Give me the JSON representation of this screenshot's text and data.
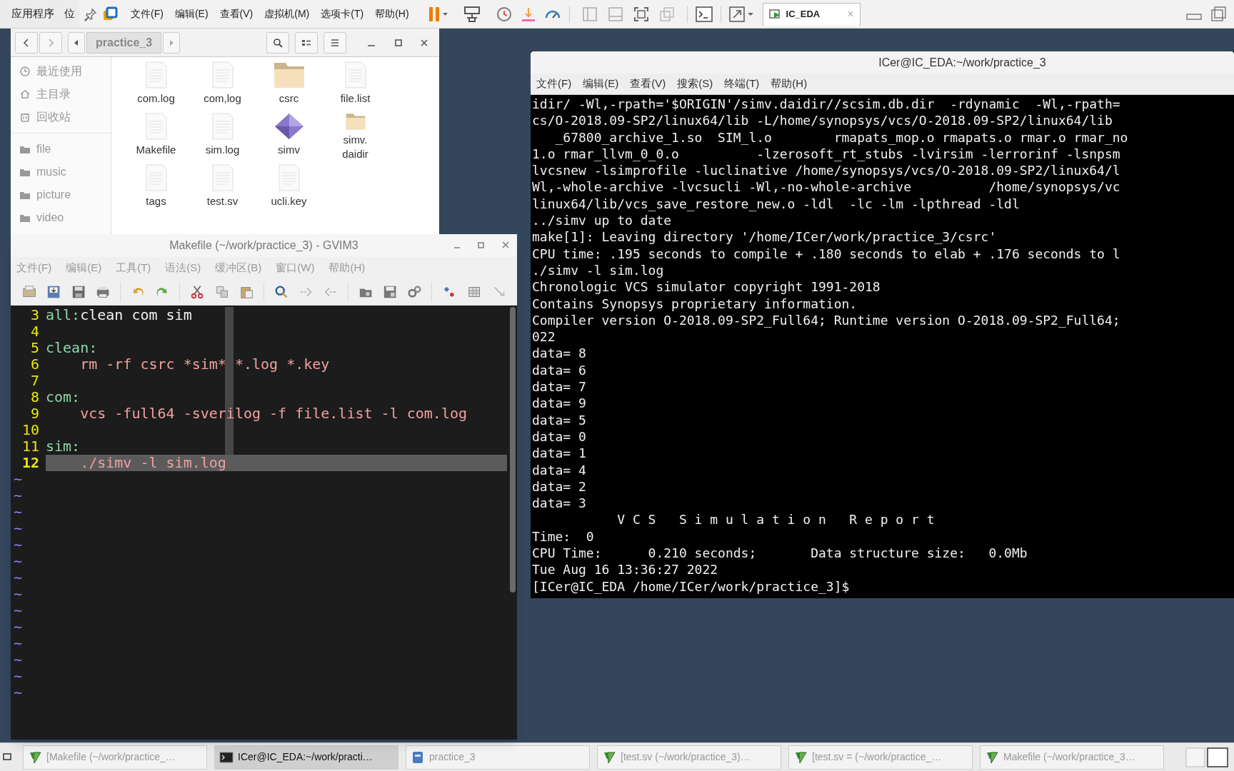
{
  "top_bar": {
    "apps_menu": "应用程序",
    "places_menu": "位",
    "vm_menus": [
      "文件(F)",
      "编辑(E)",
      "查看(V)",
      "虚拟机(M)",
      "选项卡(T)",
      "帮助(H)"
    ],
    "vm_tab": {
      "label": "IC_EDA",
      "close": "×"
    }
  },
  "file_manager": {
    "path": "practice_3",
    "sidebar": [
      {
        "label": "最近使用",
        "kind": "recent"
      },
      {
        "label": "主目录",
        "kind": "home"
      },
      {
        "label": "回收站",
        "kind": "trash"
      },
      {
        "label": "file",
        "kind": "folder"
      },
      {
        "label": "music",
        "kind": "folder"
      },
      {
        "label": "picture",
        "kind": "folder"
      },
      {
        "label": "video",
        "kind": "folder"
      }
    ],
    "files": [
      {
        "name": "com.log",
        "kind": "document"
      },
      {
        "name": "com,log",
        "kind": "document"
      },
      {
        "name": "csrc",
        "kind": "folder"
      },
      {
        "name": "file.list",
        "kind": "document"
      },
      {
        "name": "Makefile",
        "kind": "document"
      },
      {
        "name": "sim.log",
        "kind": "document"
      },
      {
        "name": "simv",
        "kind": "executable"
      },
      {
        "name": "simv.\ndaidir",
        "kind": "folder"
      },
      {
        "name": "tags",
        "kind": "document"
      },
      {
        "name": "test.sv",
        "kind": "document"
      },
      {
        "name": "ucli.key",
        "kind": "document"
      }
    ]
  },
  "gvim": {
    "title": "Makefile (~/work/practice_3) - GVIM3",
    "menus": [
      "文件(F)",
      "编辑(E)",
      "工具(T)",
      "语法(S)",
      "缓冲区(B)",
      "窗口(W)",
      "帮助(H)"
    ],
    "lines": [
      {
        "number": "3",
        "selected": false,
        "parts": [
          {
            "text": "all:",
            "kind": "target"
          },
          {
            "text": "clean com sim",
            "kind": "plain"
          }
        ]
      },
      {
        "number": "4",
        "selected": false
      },
      {
        "number": "5",
        "selected": false,
        "parts": [
          {
            "text": "clean:",
            "kind": "target"
          }
        ]
      },
      {
        "number": "6",
        "selected": false,
        "parts": [
          {
            "text": "    rm -rf csrc *sim* *.log *.key",
            "kind": "command"
          }
        ]
      },
      {
        "number": "7",
        "selected": false
      },
      {
        "number": "8",
        "selected": false,
        "parts": [
          {
            "text": "com:",
            "kind": "target"
          }
        ]
      },
      {
        "number": "9",
        "selected": false,
        "parts": [
          {
            "text": "    vcs -full64 -sverilog -f file.list -l com.log",
            "kind": "command"
          }
        ]
      },
      {
        "number": "10",
        "selected": false
      },
      {
        "number": "11",
        "selected": false,
        "parts": [
          {
            "text": "sim:",
            "kind": "target"
          }
        ]
      },
      {
        "number": "12",
        "selected": true,
        "parts": [
          {
            "text": "    ./simv -l sim.log",
            "kind": "command"
          }
        ]
      }
    ],
    "empty_markers": [
      "~",
      "~",
      "~",
      "~",
      "~",
      "~",
      "~",
      "~",
      "~",
      "~",
      "~",
      "~",
      "~",
      "~"
    ]
  },
  "terminal": {
    "title": "ICer@IC_EDA:~/work/practice_3",
    "menus": [
      "文件(F)",
      "编辑(E)",
      "查看(V)",
      "搜索(S)",
      "终端(T)",
      "帮助(H)"
    ],
    "lines": [
      "idir/ -Wl,-rpath='$ORIGIN'/simv.daidir//scsim.db.dir  -rdynamic  -Wl,-rpath=",
      "cs/O-2018.09-SP2/linux64/lib -L/home/synopsys/vcs/O-2018.09-SP2/linux64/lib",
      "   _67800_archive_1.so  SIM_l.o        rmapats_mop.o rmapats.o rmar.o rmar_no",
      "1.o rmar_llvm_0_0.o          -lzerosoft_rt_stubs -lvirsim -lerrorinf -lsnpsm",
      "lvcsnew -lsimprofile -luclinative /home/synopsys/vcs/O-2018.09-SP2/linux64/l",
      "Wl,-whole-archive -lvcsucli -Wl,-no-whole-archive          /home/synopsys/vc",
      "linux64/lib/vcs_save_restore_new.o -ldl  -lc -lm -lpthread -ldl",
      "../simv up to date",
      "make[1]: Leaving directory '/home/ICer/work/practice_3/csrc'",
      "CPU time: .195 seconds to compile + .180 seconds to elab + .176 seconds to l",
      "./simv -l sim.log",
      "Chronologic VCS simulator copyright 1991-2018",
      "Contains Synopsys proprietary information.",
      "Compiler version O-2018.09-SP2_Full64; Runtime version O-2018.09-SP2_Full64;",
      "022",
      "data= 8",
      "data= 6",
      "data= 7",
      "data= 9",
      "data= 5",
      "data= 0",
      "data= 1",
      "data= 4",
      "data= 2",
      "data= 3",
      "           V C S   S i m u l a t i o n   R e p o r t",
      "Time:  0",
      "CPU Time:      0.210 seconds;       Data structure size:   0.0Mb",
      "Tue Aug 16 13:36:27 2022",
      "[ICer@IC_EDA /home/ICer/work/practice_3]$"
    ]
  },
  "taskbar": [
    {
      "label": "[Makefile (~/work/practice_…",
      "kind": "editor",
      "selected": false
    },
    {
      "label": "ICer@IC_EDA:~/work/practi…",
      "kind": "terminal",
      "selected": true
    },
    {
      "label": "practice_3",
      "kind": "files",
      "selected": false
    },
    {
      "label": "[test.sv (~/work/practice_3)…",
      "kind": "editor",
      "selected": false
    },
    {
      "label": "[test.sv = (~/work/practice_…",
      "kind": "editor",
      "selected": false
    },
    {
      "label": "Makefile (~/work/practice_3…",
      "kind": "editor",
      "selected": false
    }
  ]
}
